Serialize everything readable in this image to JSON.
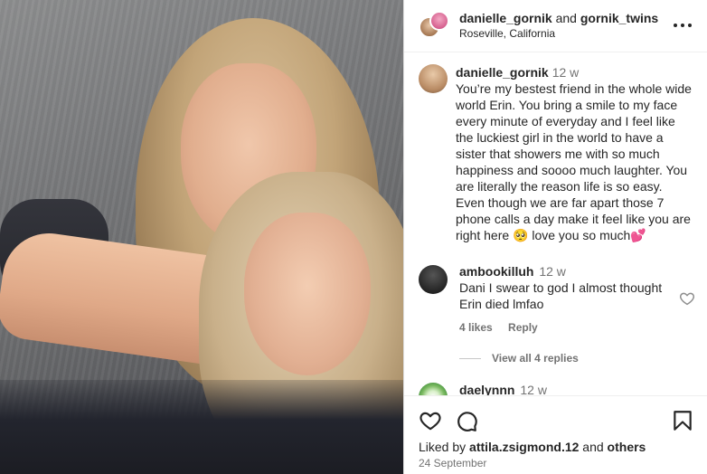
{
  "header": {
    "user1": "danielle_gornik",
    "and_text": "and",
    "user2": "gornik_twins",
    "location": "Roseville, California"
  },
  "caption": {
    "username": "danielle_gornik",
    "time": "12 w",
    "text": "You’re my bestest friend in the whole wide world Erin. You bring a smile to my face every minute of everyday and I feel like the luckiest girl in the world to have a sister that showers me with so much happiness and soooo much laughter. You are literally the reason life is so easy. Even though we are far apart those 7 phone calls a day make it feel like you are right here 🥺 love you so much💕"
  },
  "comment": {
    "username": "ambookilluh",
    "time": "12 w",
    "text": "Dani I swear to god I almost thought Erin died lmfao",
    "likes": "4 likes",
    "reply": "Reply",
    "view_replies": "View all 4 replies"
  },
  "next_comment": {
    "username": "daelynnn",
    "time": "12 w"
  },
  "footer": {
    "liked_by": "Liked by",
    "liker": "attila.zsigmond.12",
    "and": "and",
    "others": "others",
    "date": "24 September"
  },
  "icons": {
    "like": "heart-icon",
    "comment": "comment-icon",
    "save": "bookmark-icon",
    "more": "more-horizontal-icon"
  }
}
